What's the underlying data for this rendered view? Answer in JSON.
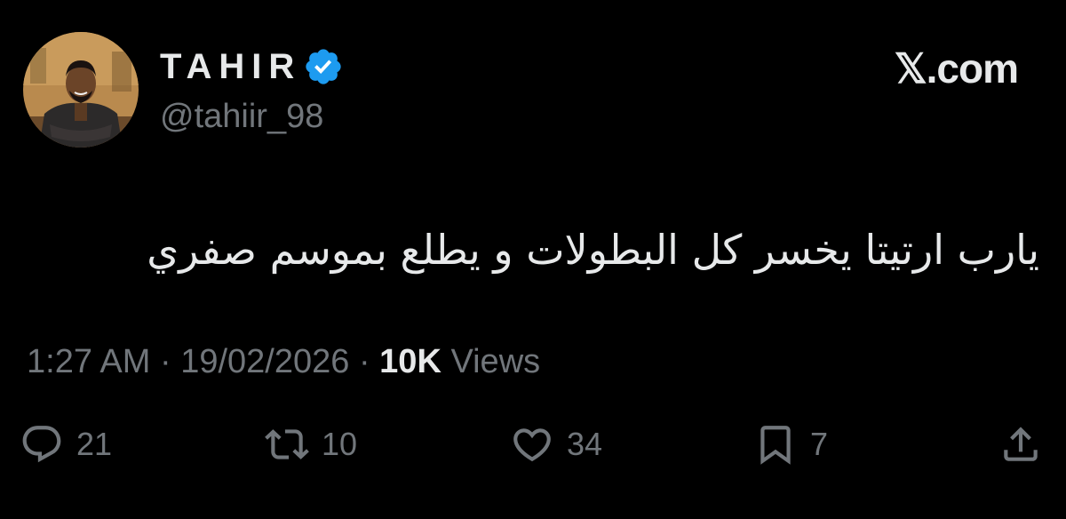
{
  "author": {
    "display_name": "TAHIR",
    "handle": "@tahiir_98",
    "verified": true,
    "verified_color": "#1d9bf0"
  },
  "site_label": "𝕏.com",
  "tweet": {
    "text": "يارب ارتيتا يخسر كل البطولات و يطلع بموسم صفري",
    "time": "1:27 AM",
    "date": "19/02/2026",
    "separator": "·",
    "views_count": "10K",
    "views_label": "Views"
  },
  "actions": {
    "replies": "21",
    "reposts": "10",
    "likes": "34",
    "bookmarks": "7"
  },
  "icons": {
    "reply": "reply-icon",
    "repost": "repost-icon",
    "like": "heart-icon",
    "bookmark": "bookmark-icon",
    "share": "share-icon",
    "verified": "verified-badge-icon"
  },
  "colors": {
    "background": "#000000",
    "primary_text": "#e7e9ea",
    "secondary_text": "#71767b"
  }
}
